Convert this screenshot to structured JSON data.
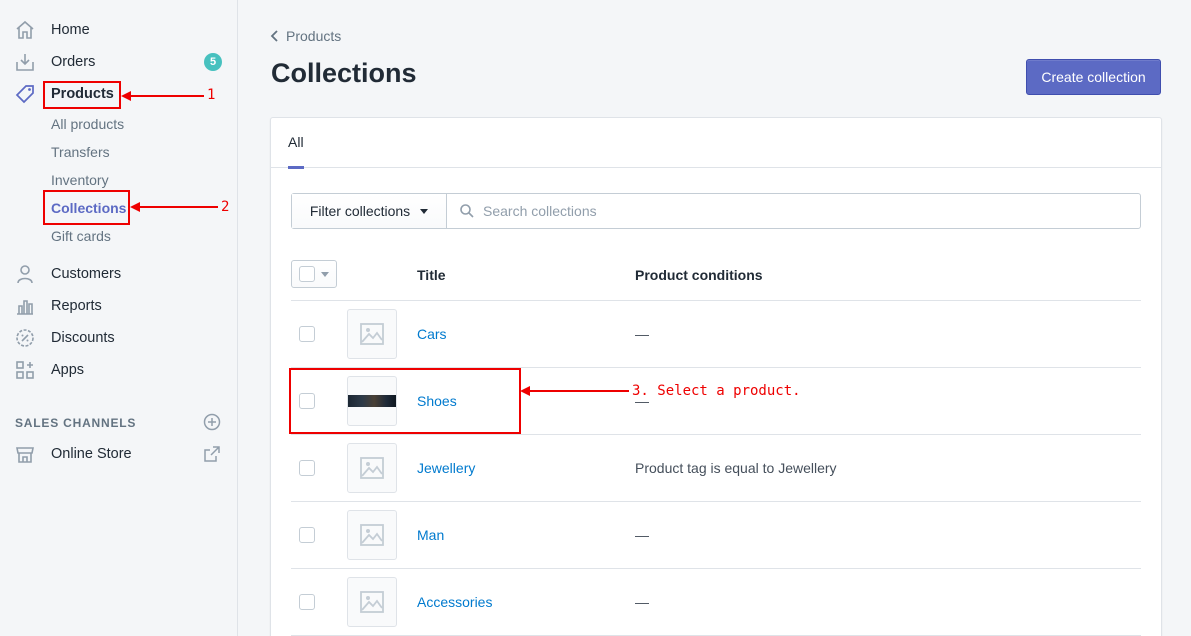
{
  "sidebar": {
    "items": [
      {
        "label": "Home"
      },
      {
        "label": "Orders",
        "badge": "5"
      },
      {
        "label": "Products"
      },
      {
        "label": "Customers"
      },
      {
        "label": "Reports"
      },
      {
        "label": "Discounts"
      },
      {
        "label": "Apps"
      }
    ],
    "product_sub": [
      "All products",
      "Transfers",
      "Inventory",
      "Collections",
      "Gift cards"
    ],
    "section_title": "SALES CHANNELS",
    "channel": "Online Store"
  },
  "main": {
    "breadcrumb": "Products",
    "title": "Collections",
    "create_button": "Create collection",
    "tab_all": "All",
    "filter_button": "Filter collections",
    "search_placeholder": "Search collections",
    "col_title": "Title",
    "col_conditions": "Product conditions",
    "rows": [
      {
        "title": "Cars",
        "conditions": "—"
      },
      {
        "title": "Shoes",
        "conditions": "—"
      },
      {
        "title": "Jewellery",
        "conditions": "Product tag is equal to Jewellery"
      },
      {
        "title": "Man",
        "conditions": "—"
      },
      {
        "title": "Accessories",
        "conditions": "—"
      }
    ]
  },
  "annotations": {
    "step1": "1",
    "step2": "2",
    "step3": "3. Select a product."
  },
  "colors": {
    "accent": "#5c6ac4",
    "link": "#007ace",
    "annotation": "#ee0000",
    "badge": "#47c1bf"
  }
}
